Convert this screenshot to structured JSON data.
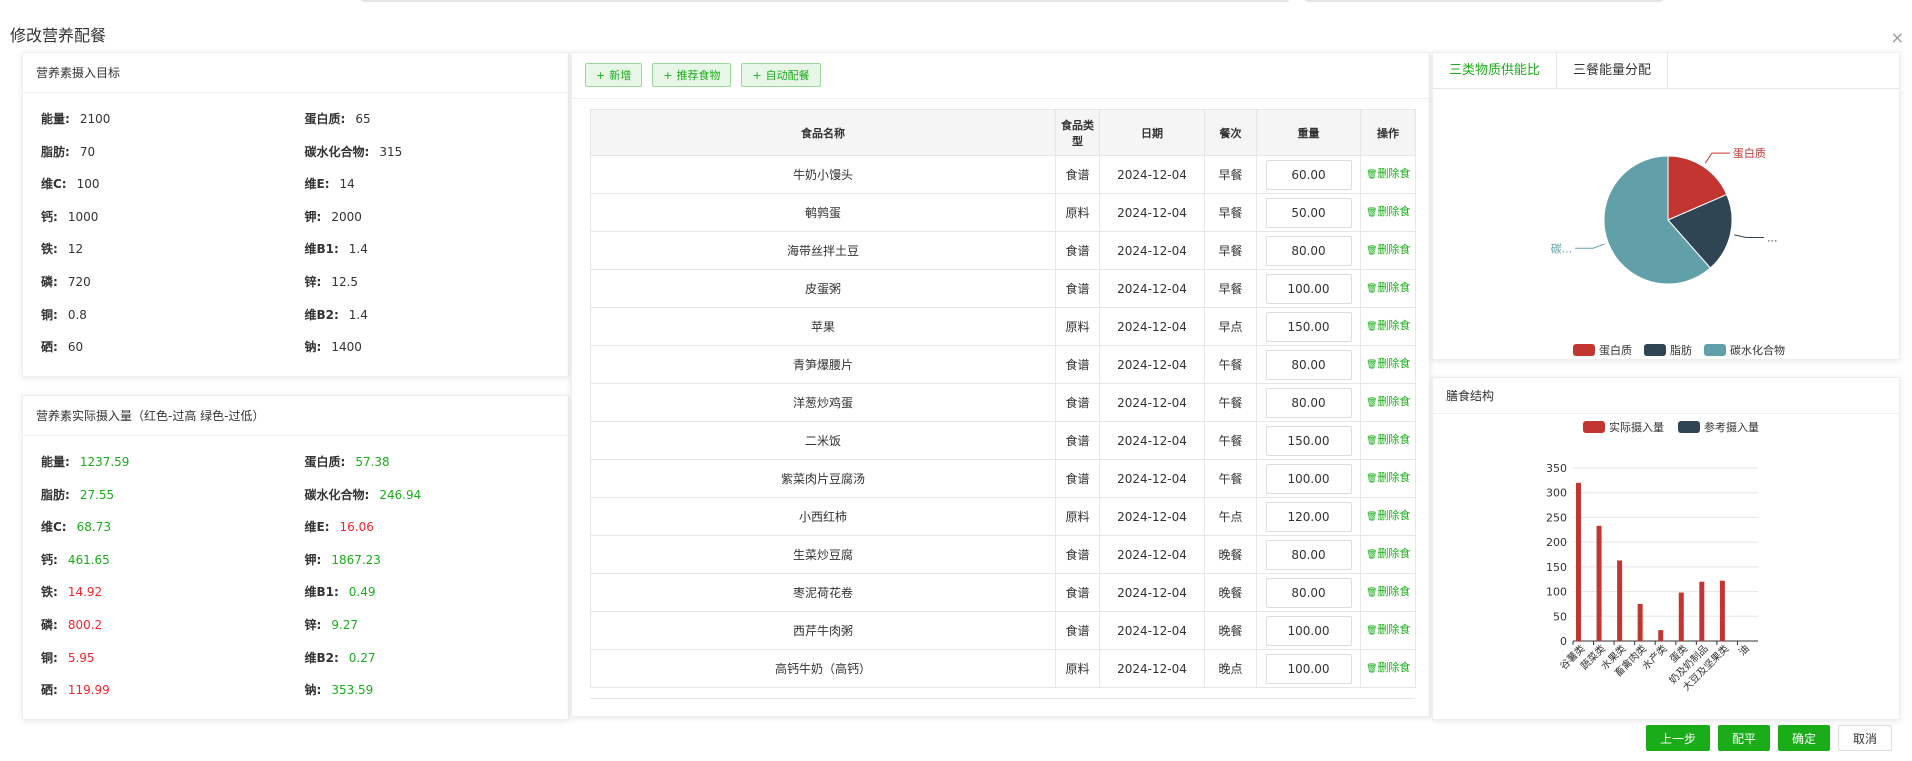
{
  "dialog": {
    "title": "修改营养配餐",
    "close": "×"
  },
  "target": {
    "title": "营养素摄入目标",
    "items": [
      {
        "k": "能量:",
        "v": "2100"
      },
      {
        "k": "蛋白质:",
        "v": "65"
      },
      {
        "k": "脂肪:",
        "v": "70"
      },
      {
        "k": "碳水化合物:",
        "v": "315"
      },
      {
        "k": "维C:",
        "v": "100"
      },
      {
        "k": "维E:",
        "v": "14"
      },
      {
        "k": "钙:",
        "v": "1000"
      },
      {
        "k": "钾:",
        "v": "2000"
      },
      {
        "k": "铁:",
        "v": "12"
      },
      {
        "k": "维B1:",
        "v": "1.4"
      },
      {
        "k": "磷:",
        "v": "720"
      },
      {
        "k": "锌:",
        "v": "12.5"
      },
      {
        "k": "铜:",
        "v": "0.8"
      },
      {
        "k": "维B2:",
        "v": "1.4"
      },
      {
        "k": "硒:",
        "v": "60"
      },
      {
        "k": "钠:",
        "v": "1400"
      }
    ]
  },
  "actual": {
    "title": "营养素实际摄入量（红色-过高 绿色-过低）",
    "items": [
      {
        "k": "能量:",
        "v": "1237.59",
        "c": "green"
      },
      {
        "k": "蛋白质:",
        "v": "57.38",
        "c": "green"
      },
      {
        "k": "脂肪:",
        "v": "27.55",
        "c": "green"
      },
      {
        "k": "碳水化合物:",
        "v": "246.94",
        "c": "green"
      },
      {
        "k": "维C:",
        "v": "68.73",
        "c": "green"
      },
      {
        "k": "维E:",
        "v": "16.06",
        "c": "red"
      },
      {
        "k": "钙:",
        "v": "461.65",
        "c": "green"
      },
      {
        "k": "钾:",
        "v": "1867.23",
        "c": "green"
      },
      {
        "k": "铁:",
        "v": "14.92",
        "c": "red"
      },
      {
        "k": "维B1:",
        "v": "0.49",
        "c": "green"
      },
      {
        "k": "磷:",
        "v": "800.2",
        "c": "red"
      },
      {
        "k": "锌:",
        "v": "9.27",
        "c": "green"
      },
      {
        "k": "铜:",
        "v": "5.95",
        "c": "red"
      },
      {
        "k": "维B2:",
        "v": "0.27",
        "c": "green"
      },
      {
        "k": "硒:",
        "v": "119.99",
        "c": "red"
      },
      {
        "k": "钠:",
        "v": "353.59",
        "c": "green"
      }
    ]
  },
  "toolbar": {
    "add": "新增",
    "recommend": "推荐食物",
    "auto": "自动配餐",
    "plus": "+"
  },
  "table": {
    "headers": [
      "食品名称",
      "食品类型",
      "日期",
      "餐次",
      "重量",
      "操作"
    ],
    "delete_label": "删除食品",
    "rows": [
      [
        "牛奶小馒头",
        "食谱",
        "2024-12-04",
        "早餐",
        "60.00"
      ],
      [
        "鹌鹑蛋",
        "原料",
        "2024-12-04",
        "早餐",
        "50.00"
      ],
      [
        "海带丝拌土豆",
        "食谱",
        "2024-12-04",
        "早餐",
        "80.00"
      ],
      [
        "皮蛋粥",
        "食谱",
        "2024-12-04",
        "早餐",
        "100.00"
      ],
      [
        "苹果",
        "原料",
        "2024-12-04",
        "早点",
        "150.00"
      ],
      [
        "青笋爆腰片",
        "食谱",
        "2024-12-04",
        "午餐",
        "80.00"
      ],
      [
        "洋葱炒鸡蛋",
        "食谱",
        "2024-12-04",
        "午餐",
        "80.00"
      ],
      [
        "二米饭",
        "食谱",
        "2024-12-04",
        "午餐",
        "150.00"
      ],
      [
        "紫菜肉片豆腐汤",
        "食谱",
        "2024-12-04",
        "午餐",
        "100.00"
      ],
      [
        "小西红柿",
        "原料",
        "2024-12-04",
        "午点",
        "120.00"
      ],
      [
        "生菜炒豆腐",
        "食谱",
        "2024-12-04",
        "晚餐",
        "80.00"
      ],
      [
        "枣泥荷花卷",
        "食谱",
        "2024-12-04",
        "晚餐",
        "80.00"
      ],
      [
        "西芹牛肉粥",
        "食谱",
        "2024-12-04",
        "晚餐",
        "100.00"
      ],
      [
        "高钙牛奶（高钙）",
        "原料",
        "2024-12-04",
        "晚点",
        "100.00"
      ]
    ]
  },
  "tabs": [
    "三类物质供能比",
    "三餐能量分配"
  ],
  "structure_title": "膳食结构",
  "colors": {
    "red": "#c23531",
    "navy": "#2f4554",
    "teal": "#61a0a8",
    "green": "#1aad19"
  },
  "chart_data": [
    {
      "type": "pie",
      "categories": [
        "蛋白质",
        "脂肪",
        "碳水化合物"
      ],
      "values": [
        18.5,
        20.0,
        61.5
      ],
      "slice_labels": [
        "蛋白质",
        "...",
        "碳..."
      ],
      "legend": [
        "蛋白质",
        "脂肪",
        "碳水化合物"
      ]
    },
    {
      "type": "bar",
      "categories": [
        "谷薯类",
        "蔬菜类",
        "水果类",
        "畜禽肉类",
        "水产类",
        "蛋类",
        "奶及奶制品",
        "大豆及坚果类",
        "油"
      ],
      "series": [
        {
          "name": "实际摄入量",
          "values": [
            320,
            233,
            163,
            75,
            22,
            98,
            120,
            122,
            0
          ]
        },
        {
          "name": "参考摄入量",
          "values": [
            0,
            0,
            0,
            0,
            0,
            0,
            0,
            0,
            0
          ]
        }
      ],
      "yticks": [
        "350",
        "300",
        "250",
        "200",
        "150",
        "100",
        "50",
        "0"
      ],
      "ylim": [
        0,
        350
      ]
    }
  ],
  "footer": {
    "prev": "上一步",
    "balance": "配平",
    "ok": "确定",
    "cancel": "取消"
  }
}
